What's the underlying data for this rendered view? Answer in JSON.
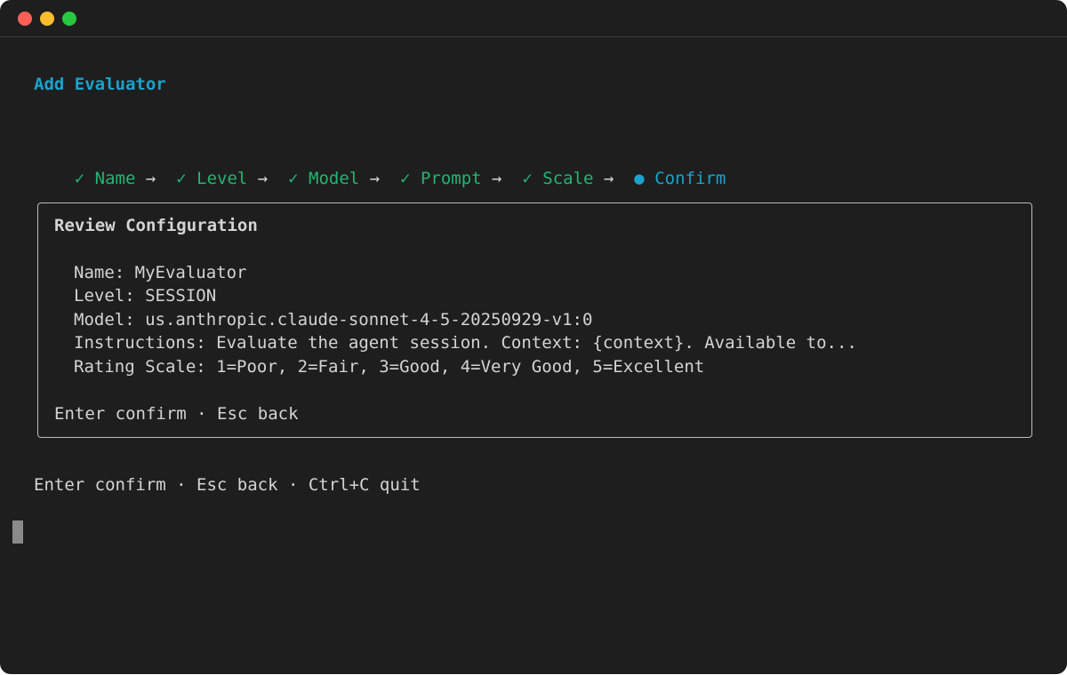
{
  "window": {
    "controls": {
      "close_color": "#ff5f57",
      "minimize_color": "#febc2e",
      "maximize_color": "#28c840"
    }
  },
  "colors": {
    "accent": "#1aa3cc",
    "done": "#22b573",
    "text": "#d4d4d4"
  },
  "header": {
    "title": "Add Evaluator"
  },
  "steps": [
    {
      "mark": "✓",
      "label": "Name",
      "state": "done"
    },
    {
      "mark": "✓",
      "label": "Level",
      "state": "done"
    },
    {
      "mark": "✓",
      "label": "Model",
      "state": "done"
    },
    {
      "mark": "✓",
      "label": "Prompt",
      "state": "done"
    },
    {
      "mark": "✓",
      "label": "Scale",
      "state": "done"
    },
    {
      "mark": "●",
      "label": "Confirm",
      "state": "current"
    }
  ],
  "step_separator": "→",
  "review": {
    "heading": "Review Configuration",
    "fields": [
      {
        "label": "Name:",
        "value": "MyEvaluator"
      },
      {
        "label": "Level:",
        "value": "SESSION"
      },
      {
        "label": "Model:",
        "value": "us.anthropic.claude-sonnet-4-5-20250929-v1:0"
      },
      {
        "label": "Instructions:",
        "value": "Evaluate the agent session. Context: {context}. Available to..."
      },
      {
        "label": "Rating Scale:",
        "value": "1=Poor, 2=Fair, 3=Good, 4=Very Good, 5=Excellent"
      }
    ],
    "hint": "Enter confirm · Esc back"
  },
  "footer": {
    "hint": "Enter confirm · Esc back · Ctrl+C quit"
  }
}
